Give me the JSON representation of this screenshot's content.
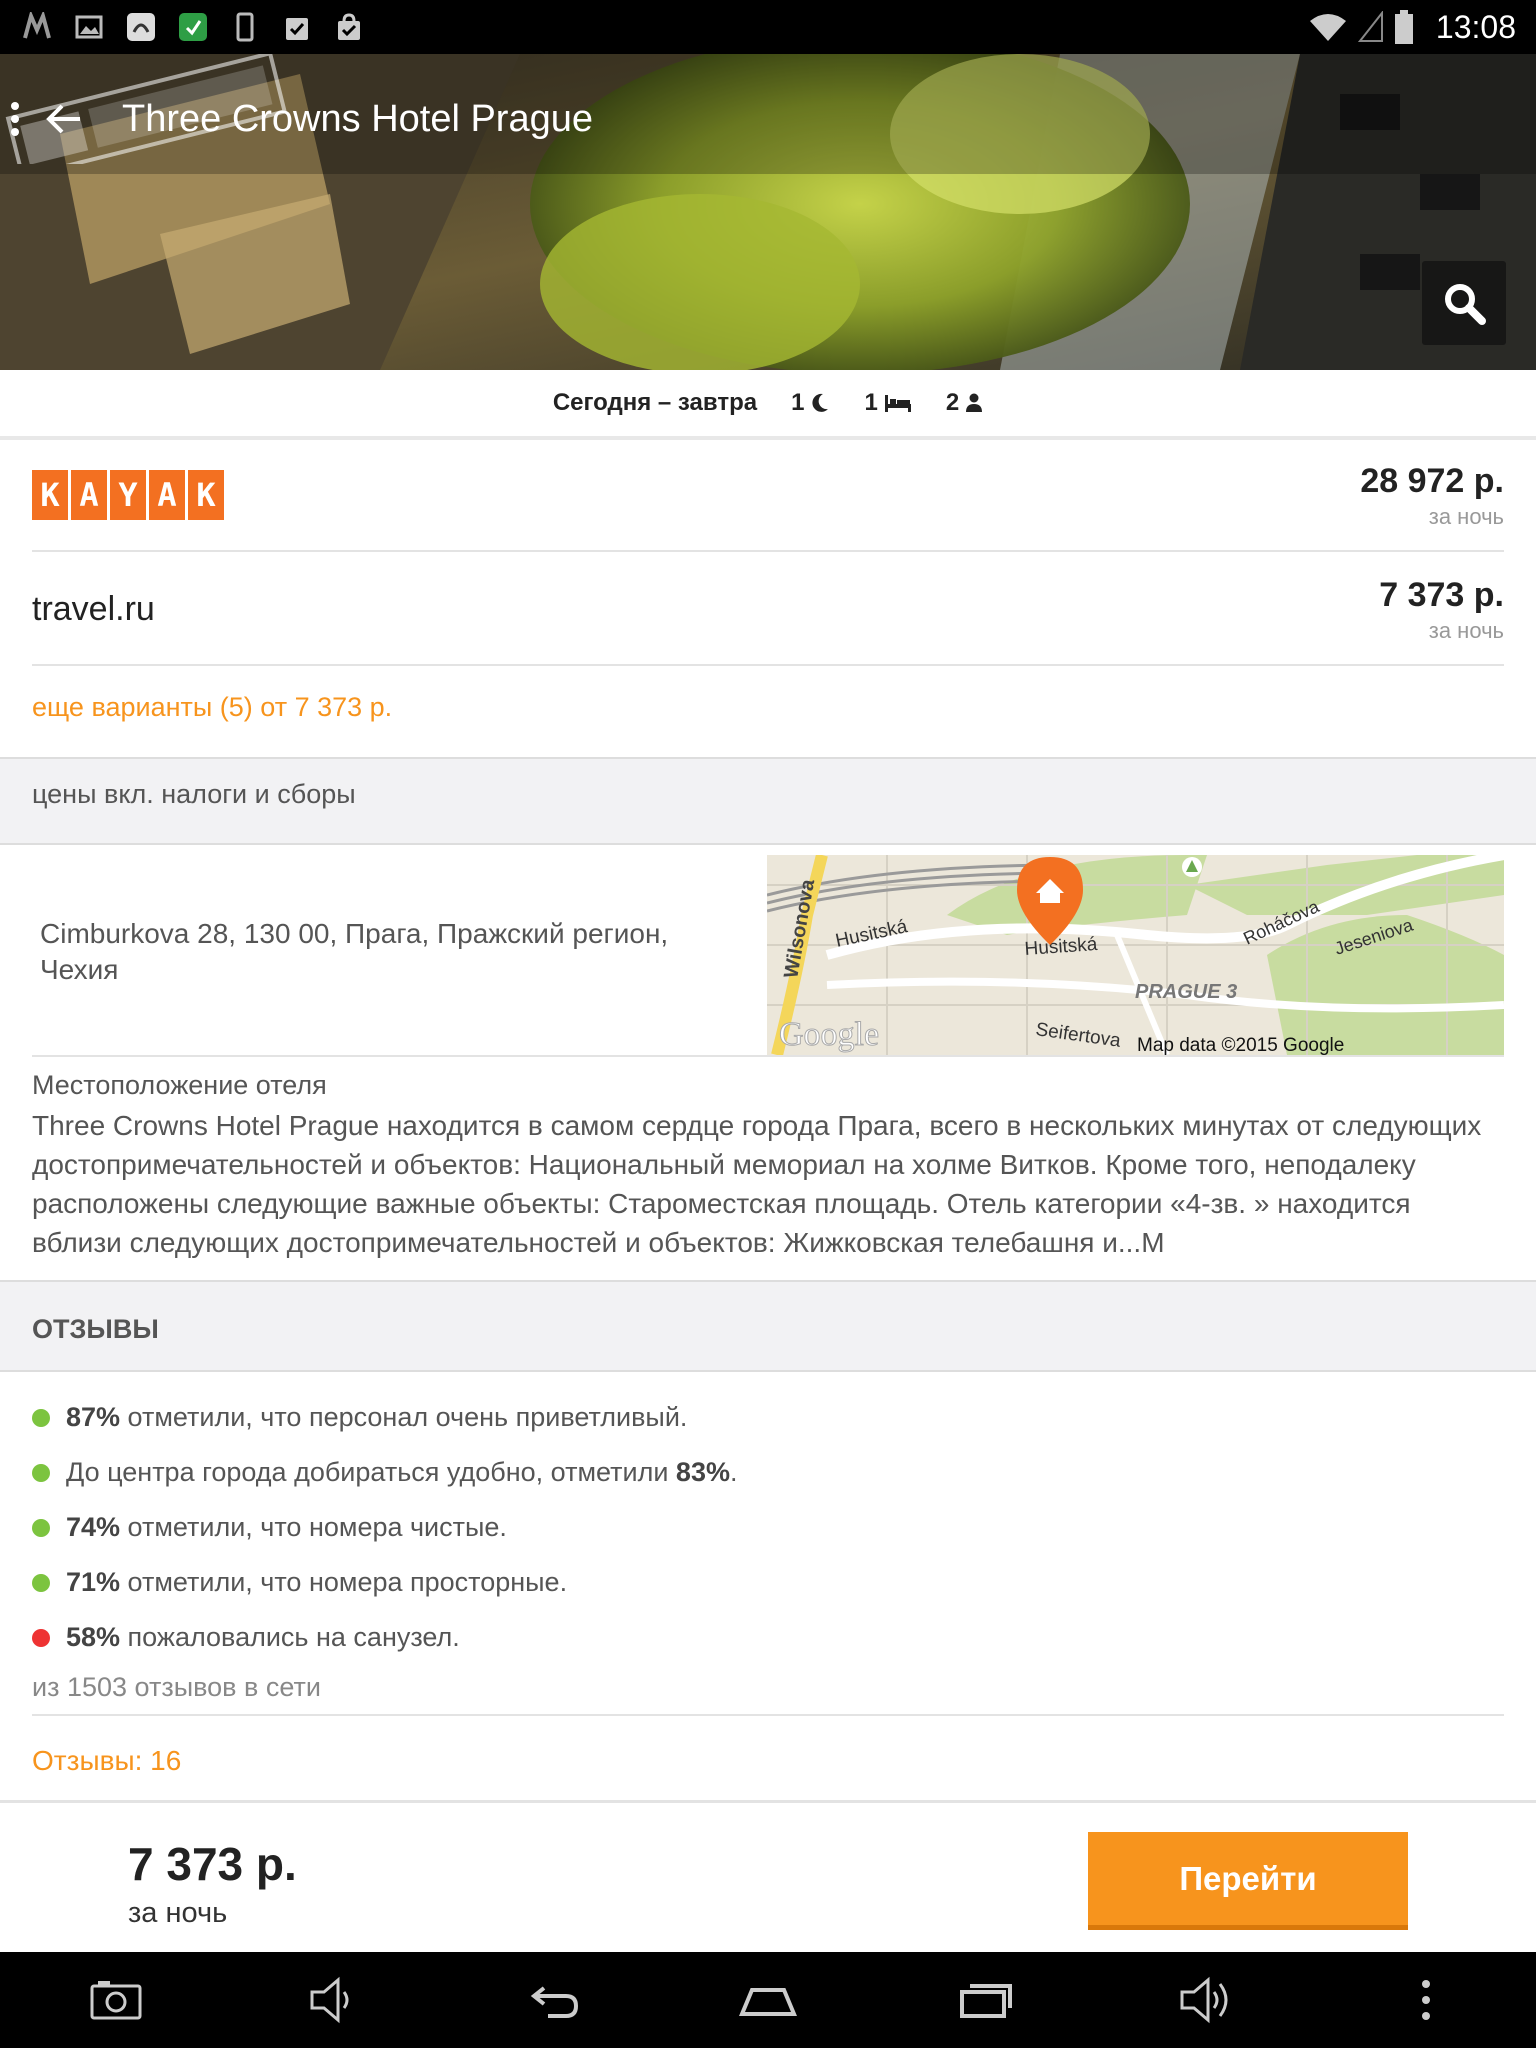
{
  "status_bar": {
    "time": "13:08"
  },
  "header": {
    "title": "Three Crowns Hotel Prague"
  },
  "stay": {
    "dates": "Сегодня – завтра",
    "nights": "1",
    "rooms": "1",
    "guests": "2"
  },
  "providers": [
    {
      "name": "KAYAK",
      "logo_letters": [
        "K",
        "A",
        "Y",
        "A",
        "K"
      ],
      "price": "28 972 р.",
      "per": "за ночь"
    },
    {
      "name": "travel.ru",
      "price": "7 373 р.",
      "per": "за ночь"
    }
  ],
  "more_options": "еще варианты (5) от 7 373 р.",
  "taxes_note": "цены вкл. налоги и сборы",
  "address": "Cimburkova 28, 130 00, Прага, Пражский регион, Чехия",
  "map": {
    "labels": [
      "Husitská",
      "Husitská",
      "Wilsonova",
      "Roháčova",
      "Jeseniova",
      "PRAGUE 3",
      "Seifertova"
    ],
    "attribution": "Map data ©2015 Google",
    "logo": "Google"
  },
  "location": {
    "title": "Местоположение отеля",
    "text": "Three Crowns Hotel Prague находится в самом сердце города Прага, всего в нескольких минутах от следующих достопримечательностей и объектов: Национальный мемориал на холме Витков. Кроме того, неподалеку расположены следующие важные объекты: Староместская площадь. Отель категории «4-зв. » находится вблизи следующих достопримечательностей и объектов: Жижковская телебашня и...М"
  },
  "reviews": {
    "heading": "ОТЗЫВЫ",
    "items": [
      {
        "pre": "",
        "bold": "87%",
        "post": " отметили, что персонал очень приветливый.",
        "color": "#7cc43f"
      },
      {
        "pre": "До центра города добираться удобно, отметили ",
        "bold": "83%",
        "post": ".",
        "color": "#7cc43f"
      },
      {
        "pre": "",
        "bold": "74%",
        "post": " отметили, что номера чистые.",
        "color": "#7cc43f"
      },
      {
        "pre": "",
        "bold": "71%",
        "post": " отметили, что номера просторные.",
        "color": "#7cc43f"
      },
      {
        "pre": "",
        "bold": "58%",
        "post": " пожаловались на санузел.",
        "color": "#ee3333"
      }
    ],
    "source_note": "из 1503 отзывов в сети",
    "count_link": "Отзывы: 16"
  },
  "footer": {
    "price": "7 373 р.",
    "per": "за ночь",
    "button": "Перейти"
  },
  "colors": {
    "accent": "#f7941d",
    "kayak": "#f37021",
    "positive": "#7cc43f",
    "negative": "#ee3333"
  }
}
